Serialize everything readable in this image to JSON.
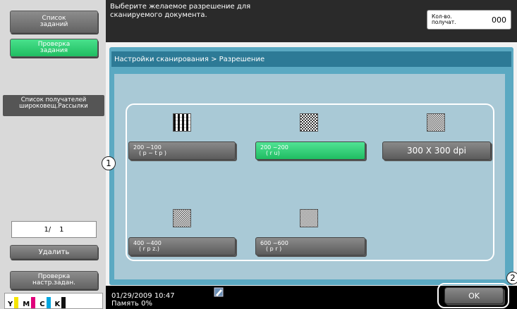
{
  "sidebar": {
    "job_list": "Список\nзаданий",
    "check_job": "Проверка\nзадания",
    "recipients_title": "Список получателей\nшироковещ.Рассылки",
    "page_current": "1/",
    "page_total": "1",
    "delete": "Удалить",
    "check_settings": "Проверка\nнастр.задан.",
    "toner": [
      {
        "label": "Y",
        "color": "#f5e400"
      },
      {
        "label": "M",
        "color": "#e0007a"
      },
      {
        "label": "C",
        "color": "#00a6e0"
      },
      {
        "label": "K",
        "color": "#111111"
      }
    ]
  },
  "message": {
    "text": "Выберите желаемое разрешение для\nсканируемого документа.",
    "copies_label": "Кол-во.\nполучат.",
    "copies_value": "000"
  },
  "panel": {
    "breadcrumb": "Настройки сканирования > Разрешение"
  },
  "options": [
    {
      "top": "200 ~100",
      "bottom": "( p ~ t p )",
      "selected": false,
      "pattern": "vertical-stripes"
    },
    {
      "top": "200 ~200",
      "bottom": "( r u)",
      "selected": true,
      "pattern": "checker"
    },
    {
      "label": "300 X 300 dpi",
      "selected": false,
      "pattern": "checker-fine"
    },
    {
      "top": "400 ~400",
      "bottom": "( r p z.)",
      "selected": false,
      "pattern": "checker-fine"
    },
    {
      "top": "600 ~600",
      "bottom": "( p r )",
      "selected": false,
      "pattern": "checker-finest"
    }
  ],
  "callouts": [
    "1",
    "2"
  ],
  "footer": {
    "datetime": "01/29/2009    10:47\nПамять          0%",
    "ok": "OK"
  }
}
